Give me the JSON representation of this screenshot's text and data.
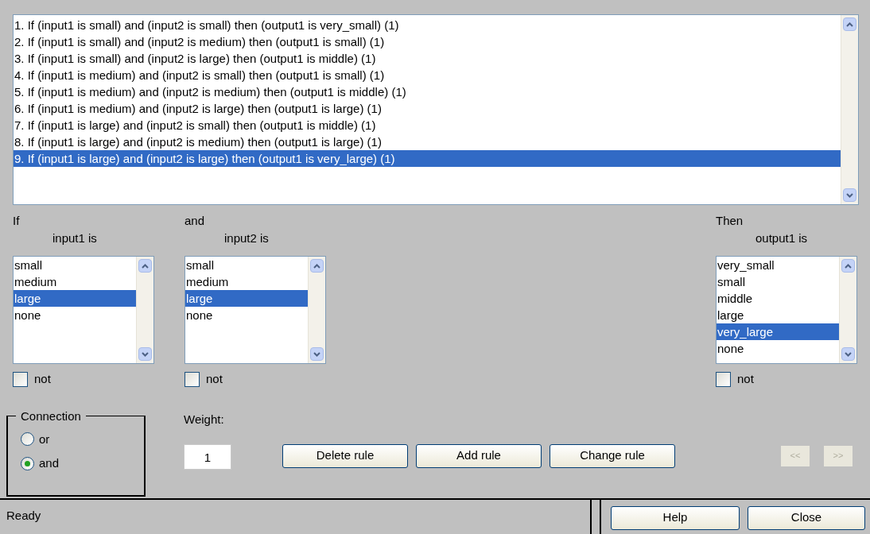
{
  "rules": [
    {
      "text": "1. If (input1 is small) and (input2 is small) then (output1 is very_small) (1)",
      "selected": false
    },
    {
      "text": "2. If (input1 is small) and (input2 is medium) then (output1 is small) (1)",
      "selected": false
    },
    {
      "text": "3. If (input1 is small) and (input2 is large) then (output1 is middle) (1)",
      "selected": false
    },
    {
      "text": "4. If (input1 is medium) and (input2 is small) then (output1 is small) (1)",
      "selected": false
    },
    {
      "text": "5. If (input1 is medium) and (input2 is medium) then (output1 is middle) (1)",
      "selected": false
    },
    {
      "text": "6. If (input1 is medium) and (input2 is large) then (output1 is large) (1)",
      "selected": false
    },
    {
      "text": "7. If (input1 is large) and (input2 is small) then (output1 is middle) (1)",
      "selected": false
    },
    {
      "text": "8. If (input1 is large) and (input2 is medium) then (output1 is large) (1)",
      "selected": false
    },
    {
      "text": "9. If (input1 is large) and (input2 is large) then (output1 is very_large) (1)",
      "selected": true
    }
  ],
  "variables": [
    {
      "kind": "input",
      "prefix": "If",
      "label": "input1 is",
      "options": [
        {
          "label": "small",
          "selected": false
        },
        {
          "label": "medium",
          "selected": false
        },
        {
          "label": "large",
          "selected": true
        },
        {
          "label": "none",
          "selected": false
        }
      ],
      "not": {
        "label": "not",
        "checked": false
      }
    },
    {
      "kind": "input",
      "prefix": "and",
      "label": "input2 is",
      "options": [
        {
          "label": "small",
          "selected": false
        },
        {
          "label": "medium",
          "selected": false
        },
        {
          "label": "large",
          "selected": true
        },
        {
          "label": "none",
          "selected": false
        }
      ],
      "not": {
        "label": "not",
        "checked": false
      }
    },
    {
      "kind": "output",
      "prefix": "Then",
      "label": "output1 is",
      "options": [
        {
          "label": "very_small",
          "selected": false
        },
        {
          "label": "small",
          "selected": false
        },
        {
          "label": "middle",
          "selected": false
        },
        {
          "label": "large",
          "selected": false
        },
        {
          "label": "very_large",
          "selected": true
        },
        {
          "label": "none",
          "selected": false
        }
      ],
      "not": {
        "label": "not",
        "checked": false
      }
    }
  ],
  "connection": {
    "title": "Connection",
    "options": [
      {
        "label": "or",
        "selected": false
      },
      {
        "label": "and",
        "selected": true
      }
    ]
  },
  "weight": {
    "label": "Weight:",
    "value": "1"
  },
  "actions": [
    "Delete rule",
    "Add rule",
    "Change rule"
  ],
  "nav_buttons": [
    {
      "label": "<<",
      "disabled": true
    },
    {
      "label": ">>",
      "disabled": true
    }
  ],
  "status_bar": {
    "text": "Ready",
    "buttons": [
      "Help",
      "Close"
    ]
  }
}
